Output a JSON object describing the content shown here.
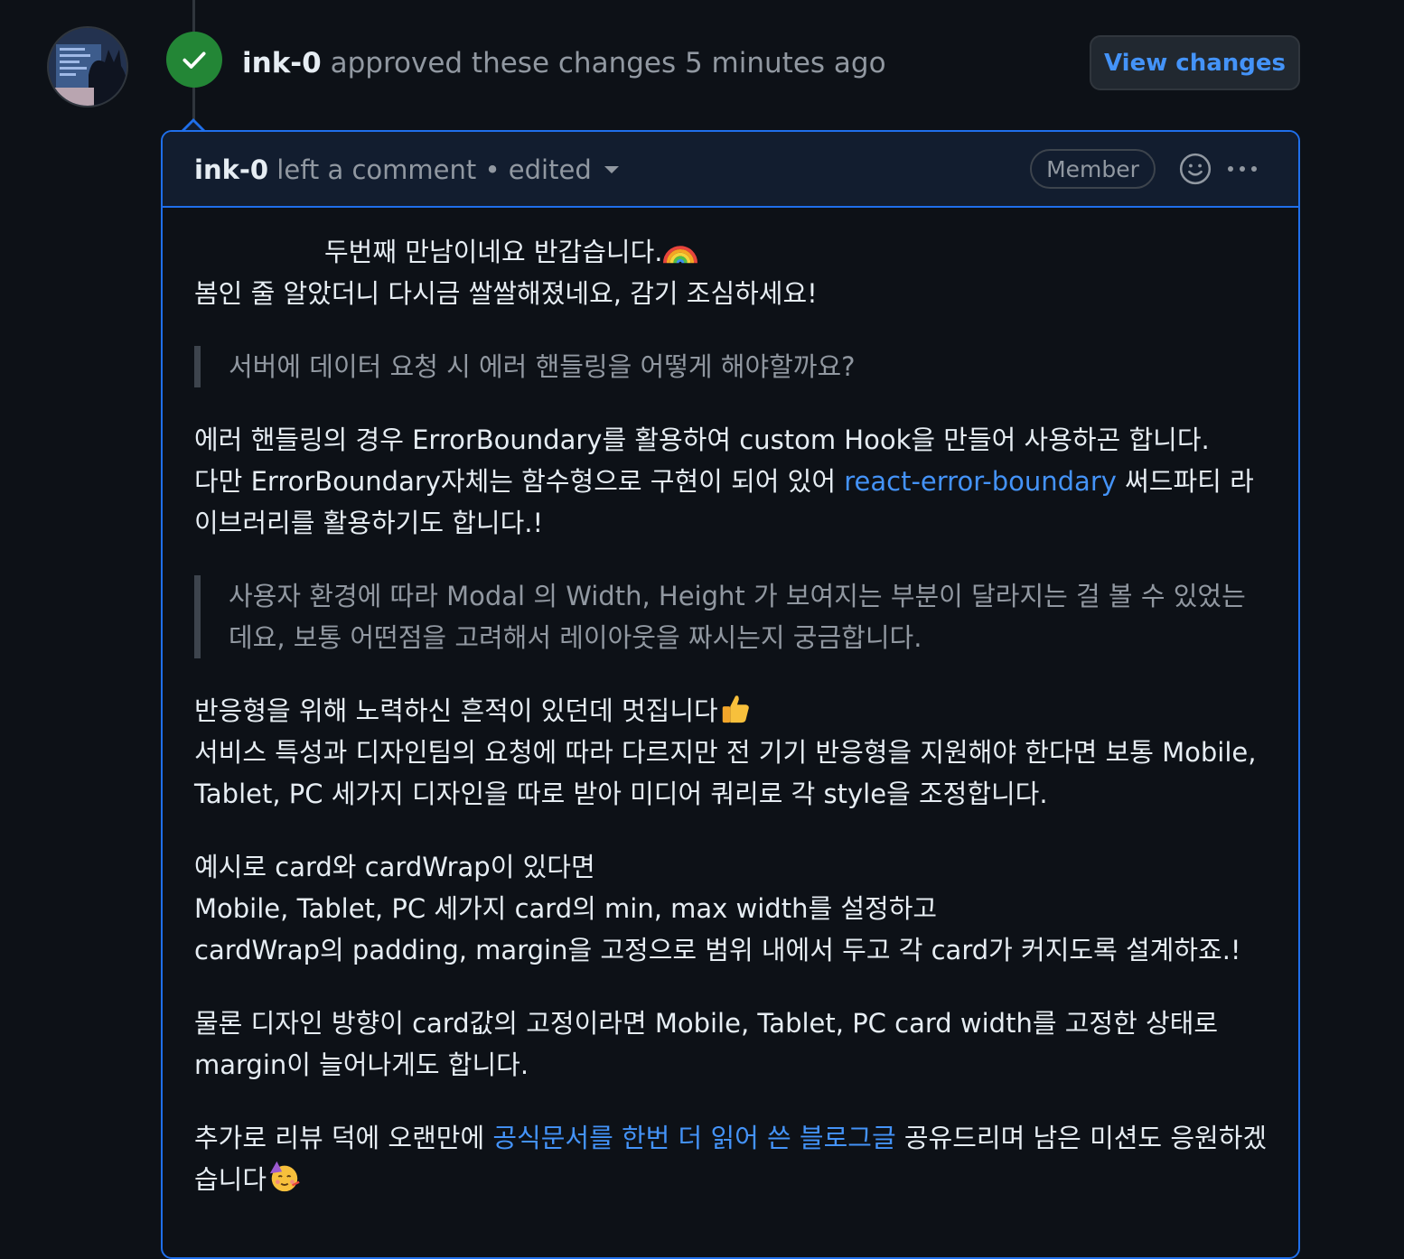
{
  "review": {
    "author": "ink-0",
    "action": " approved these changes 5 minutes ago",
    "view_changes_label": "View changes"
  },
  "comment": {
    "author": "ink-0",
    "meta": " left a comment • edited",
    "badge": "Member",
    "paragraphs": [
      {
        "line1": "두번째 만남이네요 반갑습니다.",
        "line2": "봄인 줄 알았더니 다시금 쌀쌀해졌네요, 감기 조심하세요!"
      },
      {
        "quote1": "서버에 데이터 요청 시 에러 핸들링을 어떻게 해야할까요?"
      },
      {
        "line1": "에러 핸들링의 경우 ErrorBoundary를 활용하여 custom Hook을 만들어 사용하곤 합니다.",
        "line2_pre": "다만 ErrorBoundary자체는 함수형으로 구현이 되어 있어 ",
        "line2_link": "react-error-boundary",
        "line2_post": " 써드파티 라이브러리를 활용하기도 합니다.!"
      },
      {
        "quote2": "사용자 환경에 따라 Modal 의 Width, Height 가 보여지는 부분이 달라지는 걸 볼 수 있었는데요, 보통 어떤점을 고려해서 레이아웃을 짜시는지 궁금합니다."
      },
      {
        "line1": "반응형을 위해 노력하신 흔적이 있던데 멋집니다",
        "line2": "서비스 특성과 디자인팀의 요청에 따라 다르지만 전 기기 반응형을 지원해야 한다면 보통 Mobile, Tablet, PC 세가지 디자인을 따로 받아 미디어 쿼리로 각 style을 조정합니다."
      },
      {
        "line1": "예시로 card와 cardWrap이 있다면",
        "line2": "Mobile, Tablet, PC 세가지 card의 min, max width를 설정하고",
        "line3": "cardWrap의 padding, margin을 고정으로 범위 내에서 두고 각 card가 커지도록 설계하죠.!"
      },
      {
        "line1": "물론 디자인 방향이 card값의 고정이라면 Mobile, Tablet, PC card width를 고정한 상태로 margin이 늘어나게도 합니다."
      },
      {
        "line1_pre": "추가로 리뷰 덕에 오랜만에 ",
        "line1_link": "공식문서를 한번 더 읽어 쓴 블로그글",
        "line1_post": " 공유드리며 남은 미션도 응원하겠습니다"
      }
    ]
  },
  "icons": {
    "avatar": "avatar-image",
    "status": "check-icon",
    "reaction": "smiley-icon",
    "menu": "kebab-icon",
    "emoji_rainbow": "rainbow-emoji",
    "emoji_thumbs": "thumbs-up-emoji",
    "emoji_party": "partying-face-emoji"
  },
  "colors": {
    "background": "#0d1117",
    "accent_border": "#1f6feb",
    "header_bg": "#121d2f",
    "link": "#4493f8",
    "approve_green": "#238636",
    "muted_text": "#9198a1",
    "primary_text": "#e6edf3"
  }
}
